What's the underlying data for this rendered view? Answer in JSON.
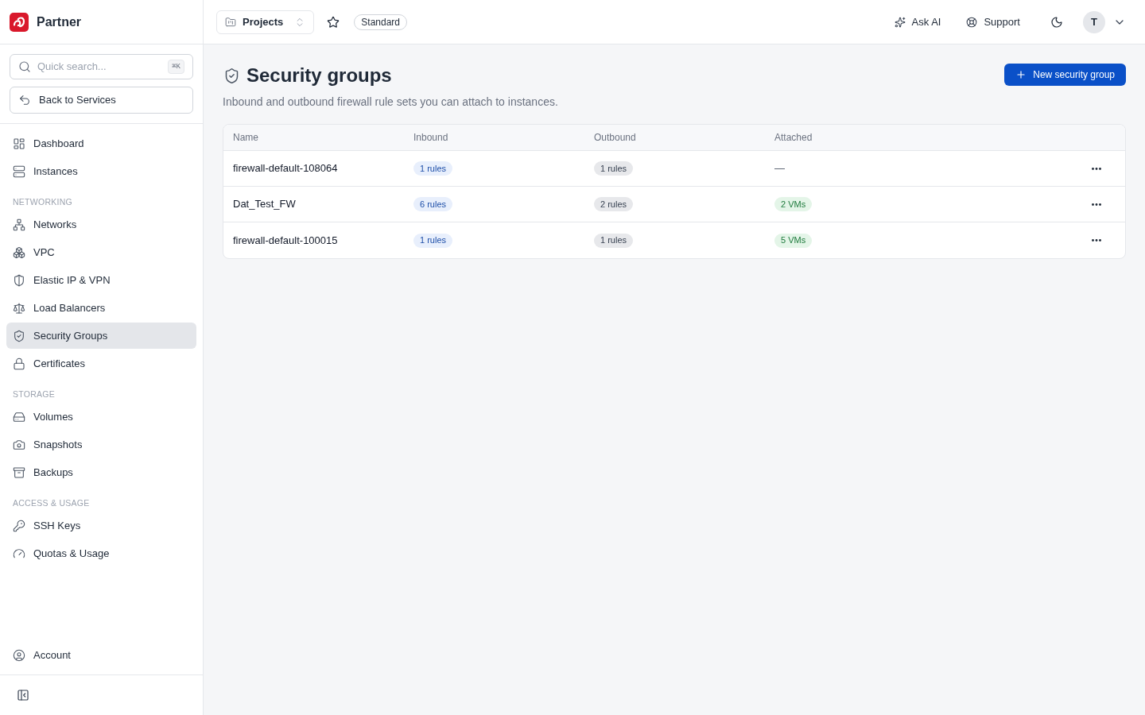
{
  "sidebar": {
    "brand": "Partner",
    "search": {
      "placeholder": "Quick search...",
      "shortcut": "⌘K"
    },
    "back_button": "Back to Services",
    "items": [
      {
        "label": "Dashboard",
        "selected": false
      },
      {
        "label": "Instances",
        "selected": false
      }
    ],
    "sections": [
      {
        "heading": "NETWORKING",
        "items": [
          {
            "label": "Networks",
            "selected": false
          },
          {
            "label": "VPC",
            "selected": false
          },
          {
            "label": "Elastic IP & VPN",
            "selected": false
          },
          {
            "label": "Load Balancers",
            "selected": false
          },
          {
            "label": "Security Groups",
            "selected": true
          },
          {
            "label": "Certificates",
            "selected": false
          }
        ]
      },
      {
        "heading": "STORAGE",
        "items": [
          {
            "label": "Volumes",
            "selected": false
          },
          {
            "label": "Snapshots",
            "selected": false
          },
          {
            "label": "Backups",
            "selected": false
          }
        ]
      },
      {
        "heading": "ACCESS & USAGE",
        "items": [
          {
            "label": "SSH Keys",
            "selected": false
          },
          {
            "label": "Quotas & Usage",
            "selected": false
          }
        ]
      }
    ],
    "footer_items": [
      {
        "label": "Account",
        "selected": false
      }
    ]
  },
  "topbar": {
    "project_selector": "Projects",
    "plan_badge": "Standard",
    "actions": [
      "Ask AI",
      "Support"
    ],
    "avatar": "T"
  },
  "page": {
    "title": "Security groups",
    "subtitle": "Inbound and outbound firewall rule sets you can attach to instances.",
    "primary_button": "New security group"
  },
  "table": {
    "columns": [
      "Name",
      "Inbound",
      "Outbound",
      "Attached"
    ],
    "rows": [
      {
        "name": "firewall-default-108064",
        "inbound": "1 rules",
        "outbound": "1 rules",
        "attached": {
          "kind": "plain",
          "text": "—"
        }
      },
      {
        "name": "Dat_Test_FW",
        "inbound": "6 rules",
        "outbound": "2 rules",
        "attached": {
          "kind": "badge",
          "text": "2 VMs"
        }
      },
      {
        "name": "firewall-default-100015",
        "inbound": "1 rules",
        "outbound": "1 rules",
        "attached": {
          "kind": "badge",
          "text": "5 VMs"
        }
      }
    ]
  }
}
